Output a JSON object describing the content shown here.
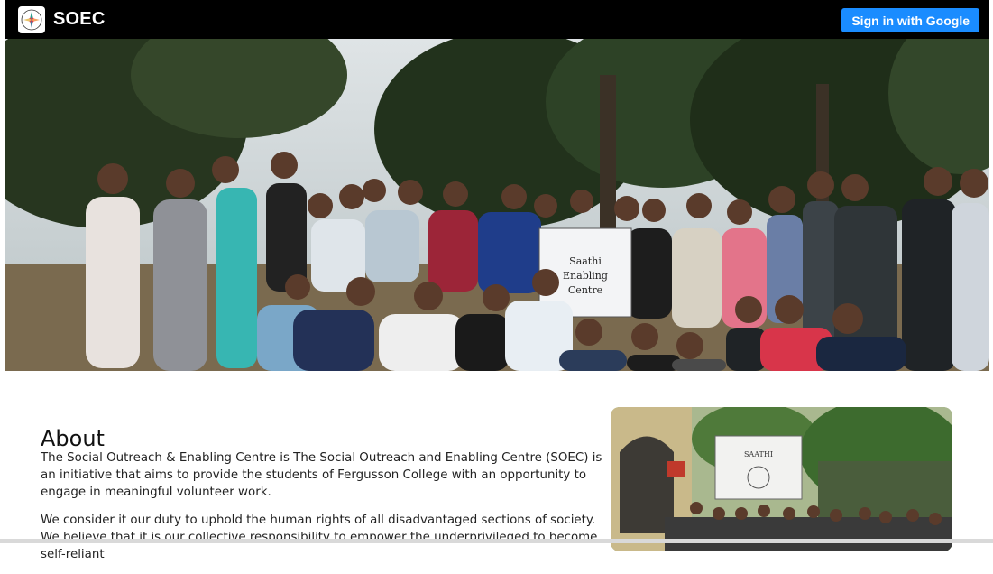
{
  "header": {
    "brand": "SOEC",
    "signin_label": "Sign in with Google",
    "logo_icon": "soec-logo-icon",
    "background": "#000000",
    "button_color": "#1a8cff"
  },
  "hero": {
    "image": "group-photo-volunteers",
    "sign_text": "Saathi Enabling Centre"
  },
  "about": {
    "title": "About",
    "paragraph1": "The Social Outreach & Enabling Centre is The Social Outreach and Enabling Centre (SOEC) is an initiative that aims to provide the students of Fergusson College with an opportunity to engage in meaningful volunteer work.",
    "paragraph2": "We consider it our duty to uphold the human rights of all disadvantaged sections of society. We believe that it is our collective responsibility to empower the underprivileged to become self-reliant",
    "photo": "saathi-banner-group-photo",
    "banner_text": "SAATHI"
  }
}
